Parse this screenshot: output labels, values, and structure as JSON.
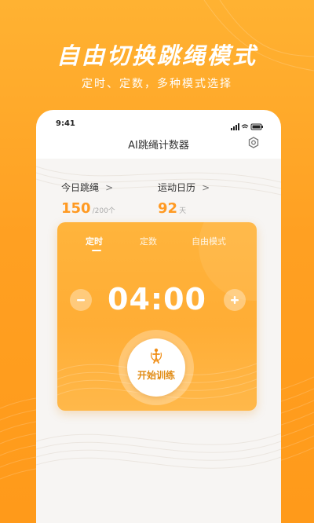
{
  "promo": {
    "title": "自由切换跳绳模式",
    "subtitle": "定时、定数，多种模式选择"
  },
  "status_bar": {
    "time": "9:41"
  },
  "app": {
    "title": "AI跳绳计数器"
  },
  "stats": {
    "today": {
      "label": "今日跳绳",
      "value": "150",
      "unit": "/200个",
      "chevron": ">"
    },
    "calendar": {
      "label": "运动日历",
      "value": "92",
      "unit": "天",
      "chevron": ">"
    }
  },
  "timer": {
    "tabs": [
      {
        "label": "定时",
        "active": true
      },
      {
        "label": "定数",
        "active": false
      },
      {
        "label": "自由模式",
        "active": false
      }
    ],
    "time": "04:00",
    "minus_label": "−",
    "plus_label": "+",
    "start_label": "开始训练"
  },
  "colors": {
    "accent": "#ff9a23",
    "card": "#ffb03a",
    "background": "#ffa022"
  }
}
